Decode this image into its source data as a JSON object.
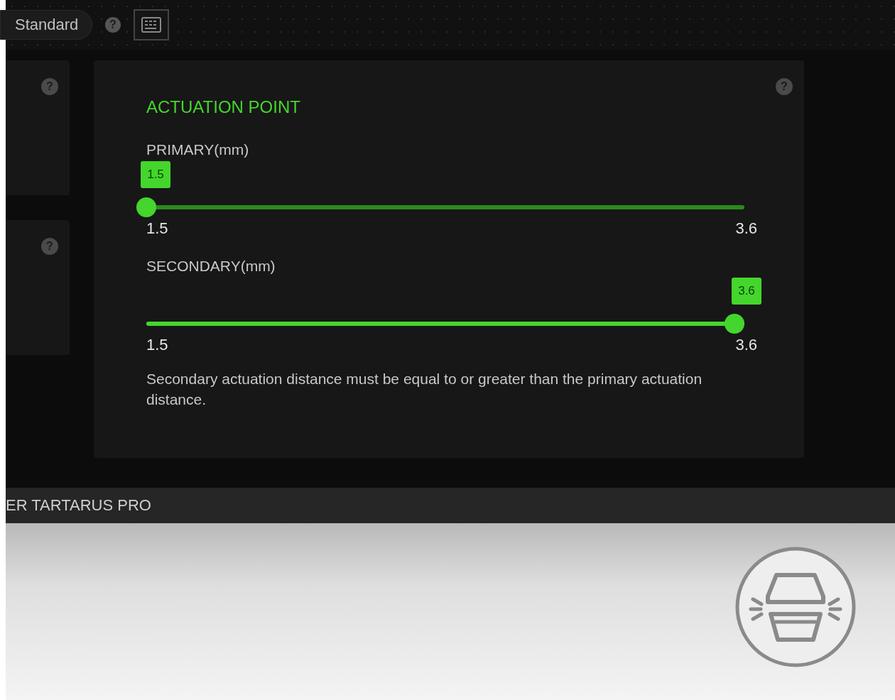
{
  "top_bar": {
    "mode": "Standard",
    "help": "?"
  },
  "side_cards": [
    {
      "help": "?"
    },
    {
      "help": "?"
    }
  ],
  "panel": {
    "help": "?",
    "title": "ACTUATION POINT",
    "sliders": [
      {
        "label": "PRIMARY(mm)",
        "value": "1.5",
        "level": 0,
        "min": "1.5",
        "max": "3.6"
      },
      {
        "label": "SECONDARY(mm)",
        "value": "3.6",
        "level": 1,
        "min": "1.5",
        "max": "3.6"
      }
    ],
    "note": "Secondary actuation distance must be equal to or greater than the primary actuation distance."
  },
  "device_bar": {
    "name": "ER TARTARUS PRO"
  }
}
